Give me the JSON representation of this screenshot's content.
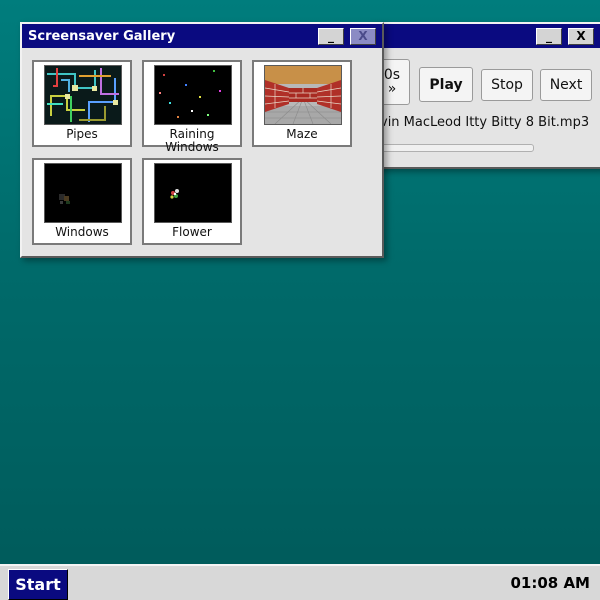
{
  "player": {
    "skip_label_top": "0s",
    "skip_label_bottom": "»",
    "play_label": "Play",
    "stop_label": "Stop",
    "next_label": "Next",
    "track_name": "vin MacLeod Itty Bitty 8 Bit.mp3",
    "minimize": "_",
    "close": "X",
    "progress": 0
  },
  "gallery": {
    "title": "Screensaver Gallery",
    "minimize": "_",
    "close": "X",
    "items": [
      {
        "label": "Pipes",
        "thumb": "pipes-preview"
      },
      {
        "label": "Raining Windows",
        "thumb": "raining-windows-preview"
      },
      {
        "label": "Maze",
        "thumb": "maze-preview"
      },
      {
        "label": "Windows",
        "thumb": "windows-preview"
      },
      {
        "label": "Flower",
        "thumb": "flower-preview"
      }
    ]
  },
  "taskbar": {
    "start_label": "Start",
    "clock": "01:08 AM"
  },
  "colors": {
    "desktop": "#007373",
    "titlebar": "#0a0a80",
    "window": "#e4e4e4"
  }
}
